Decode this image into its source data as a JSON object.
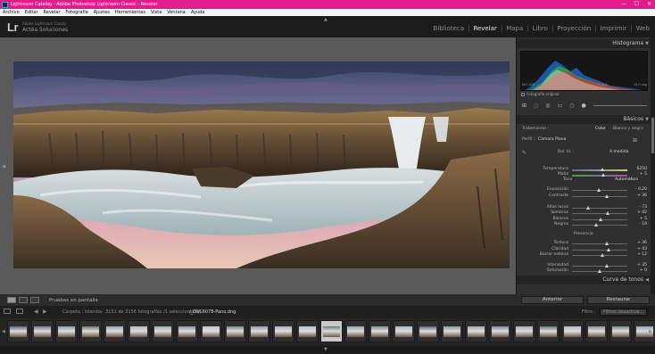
{
  "window": {
    "title": "Lightroom Catalog - Adobe Photoshop Lightroom Classic - Revelar",
    "min": "—",
    "max": "☐",
    "close": "✕"
  },
  "menu": [
    "Archivo",
    "Editar",
    "Revelar",
    "Fotografía",
    "Ajustes",
    "Herramientas",
    "Vista",
    "Ventana",
    "Ayuda"
  ],
  "identity": {
    "logo": "Lr",
    "subtitle": "Adobe Lightroom Classic",
    "name": "Actéa Soluciones"
  },
  "modules": [
    "Biblioteca",
    "Revelar",
    "Mapa",
    "Libro",
    "Proyección",
    "Imprimir",
    "Web"
  ],
  "active_module": "Revelar",
  "toolbar": {
    "label": "Pruebas en pantalla"
  },
  "panel": {
    "histogram_title": "Histograma",
    "histogram_info": [
      "ISO 100",
      "11 mm",
      "f / 8,0",
      "15,0 seg"
    ],
    "original_photo": "Fotografía original",
    "basics_title": "Básicos",
    "treatment_label": "Tratamiento :",
    "treatment_color": "Color",
    "treatment_bw": "Blanco y negro",
    "profile_label": "Perfil :",
    "profile_value": "Cámara Plana",
    "wb_label": "Bal. bl. :",
    "wb_value": "A medida",
    "tone_label": "Tono",
    "tone_auto": "Automático",
    "presence_label": "Presencia",
    "curve_title": "Curva de tonos",
    "sliders": [
      {
        "label": "Temperatura",
        "value": "6250"
      },
      {
        "label": "Matiz",
        "value": "+ 5"
      },
      {
        "label": "Exposición",
        "value": "- 0,20"
      },
      {
        "label": "Contraste",
        "value": "+ 36"
      },
      {
        "label": "Altas luces",
        "value": "- 73"
      },
      {
        "label": "Sombras",
        "value": "+ 42"
      },
      {
        "label": "Blancos",
        "value": "+ 5"
      },
      {
        "label": "Negros",
        "value": "- 19"
      },
      {
        "label": "Textura",
        "value": "+ 36"
      },
      {
        "label": "Claridad",
        "value": "+ 43"
      },
      {
        "label": "Borrar neblina",
        "value": "+ 12"
      },
      {
        "label": "Intensidad",
        "value": "+ 35"
      },
      {
        "label": "Saturación",
        "value": "+ 0"
      }
    ],
    "prev_button": "Anterior",
    "reset_button": "Restaurar"
  },
  "filmstrip": {
    "folder": "Carpeta : Islandia",
    "count": "3151 de 3156 fotografías /1 seleccionada/s",
    "filename": "/_DSC6078-Pano.dng",
    "filter_label": "Filtro :",
    "filter_value": "Filtros desactiva..."
  }
}
